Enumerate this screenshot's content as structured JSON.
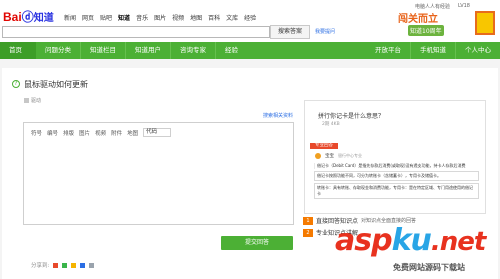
{
  "header": {
    "logo_bai": "Bai",
    "logo_paw": "ⓓ",
    "logo_zhi": "知道",
    "nav": [
      "新闻",
      "网页",
      "贴吧",
      "知道",
      "音乐",
      "图片",
      "视频",
      "地图",
      "百科",
      "文库",
      "经验"
    ],
    "right_links": [
      "电脑人人有经验",
      "LV18"
    ],
    "search_button": "搜索答案",
    "search_side": "我要提问"
  },
  "promo": {
    "title": "闯关而立",
    "sub": "知道10周年"
  },
  "navbar": {
    "items": [
      "首页",
      "问题分类",
      "知道栏目",
      "知道用户",
      "咨询专家",
      "经验"
    ],
    "right_items": [
      "开放平台",
      "手机知道",
      "个人中心"
    ]
  },
  "question": {
    "icon": "?",
    "title": "鼠标驱动如何更新",
    "tag": "驱动"
  },
  "editor": {
    "link": "搜索相关资料",
    "toolbar": [
      "符号",
      "编号",
      "排版",
      "图片",
      "视频",
      "附件",
      "地图"
    ],
    "code_select": "代码"
  },
  "submit_label": "提交回答",
  "share_label": "分享到:",
  "tip": {
    "title": "拼行你记卡是什么意思？",
    "meta": "2期  4KB",
    "tag": "专业回答",
    "user_name": "宝宝",
    "user_info": "银行中心专业",
    "lines": [
      "借记卡（Debit Card）是指先存款后消费(或取现)没有透支功能，持卡人存款后消费",
      "借记卡按照功能不同，可分为转账卡（含储蓄卡），专用卡及储值卡。",
      "转账卡：具有转账、存取现金和消费功能，专用卡：是在特定区域、专门用途使用的借记卡"
    ]
  },
  "bullets": [
    {
      "mark": "1",
      "title": "直接回答知识点",
      "desc": "对知识点全面直接的回答"
    },
    {
      "mark": "2",
      "title": "专业知识点讲解",
      "desc": ""
    }
  ],
  "watermark": {
    "asp": "asp",
    "ku": "ku",
    "net": ".net",
    "sub": "免费网站源码下载站"
  }
}
